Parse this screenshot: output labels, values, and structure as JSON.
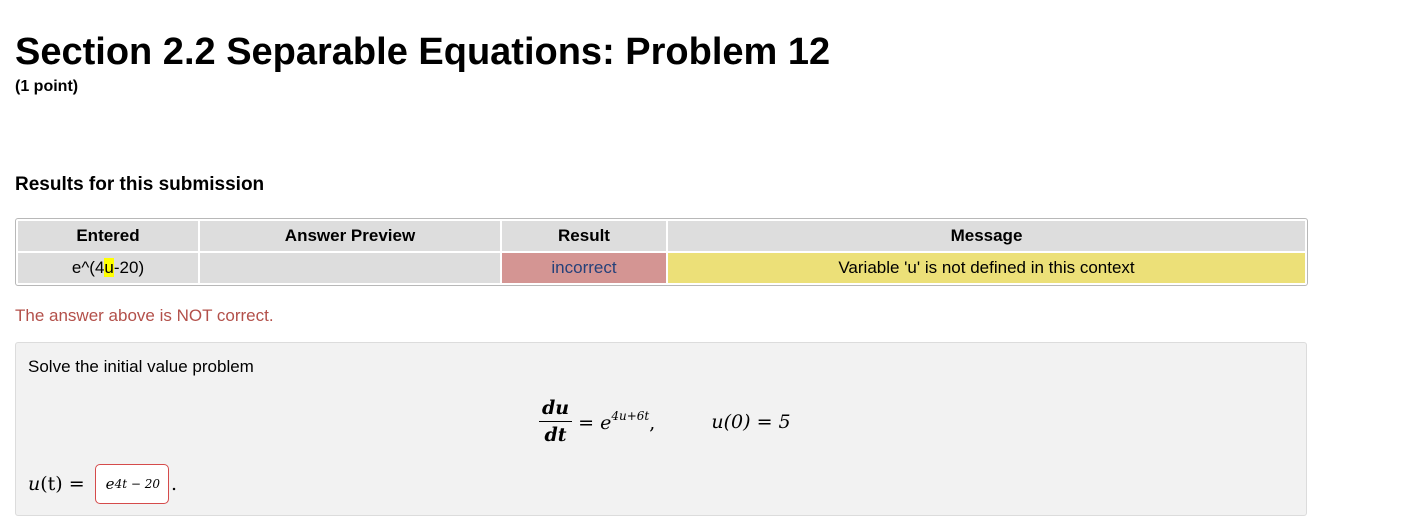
{
  "header": {
    "title": "Section 2.2 Separable Equations: Problem 12",
    "points": "(1 point)"
  },
  "results": {
    "heading": "Results for this submission",
    "columns": [
      "Entered",
      "Answer Preview",
      "Result",
      "Message"
    ],
    "row": {
      "entered_prefix": "e^(4",
      "entered_highlight": "u",
      "entered_suffix": "-20)",
      "preview": "",
      "result": "incorrect",
      "message": "Variable 'u' is not defined in this context"
    },
    "status_text": "The answer above is NOT correct.",
    "colors": {
      "incorrect_cell": "#d49593",
      "message_cell": "#ece078",
      "highlight": "#ffff00",
      "status_text": "#b3504a"
    }
  },
  "problem": {
    "prompt": "Solve the initial value problem",
    "equation": {
      "lhs_numerator": "du",
      "lhs_denominator": "dt",
      "equals_base": "= e",
      "exponent": "4u+6t",
      "comma": ",",
      "condition": "u(0) = 5"
    },
    "answer": {
      "label_var": "u",
      "label_paren": "(t) =",
      "value_base": "e",
      "value_exponent": "4t − 20",
      "trailing": "."
    }
  }
}
